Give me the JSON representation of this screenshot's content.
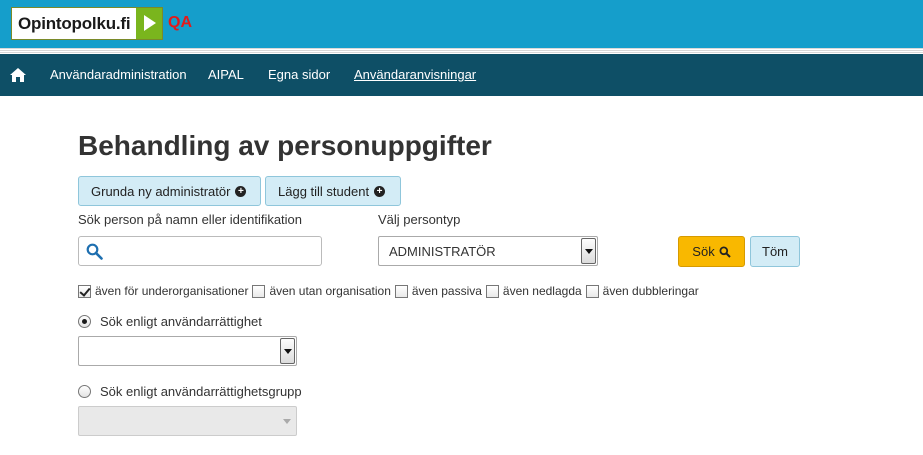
{
  "header": {
    "logo_text": "Opintopolku.fi",
    "env_label": "QA",
    "brand_color": "#159ecb",
    "env_color": "#e21a1a"
  },
  "nav": {
    "home_icon": "home-icon",
    "items": [
      {
        "label": "Användaradministration"
      },
      {
        "label": "AIPAL"
      },
      {
        "label": "Egna sidor"
      },
      {
        "label": "Användaranvisningar"
      }
    ],
    "bar_color": "#0e4f66"
  },
  "main": {
    "title": "Behandling av personuppgifter",
    "create_admin_label": "Grunda ny administratör",
    "add_student_label": "Lägg till student",
    "search_label": "Sök person på namn eller identifikation",
    "search_value": "",
    "person_type_label": "Välj persontyp",
    "person_type_value": "ADMINISTRATÖR",
    "search_button": "Sök",
    "clear_button": "Töm",
    "search_button_color": "#f9b800",
    "checkboxes": [
      {
        "label": "även för underorganisationer",
        "checked": true
      },
      {
        "label": "även utan organisation",
        "checked": false
      },
      {
        "label": "även passiva",
        "checked": false
      },
      {
        "label": "även nedlagda",
        "checked": false
      },
      {
        "label": "även dubbleringar",
        "checked": false
      }
    ],
    "radio_rights_label": "Sök enligt användarrättighet",
    "radio_rights_selected": true,
    "rights_select_value": "",
    "radio_group_label": "Sök enligt användarrättighetsgrupp",
    "radio_group_selected": false,
    "group_select_value": ""
  }
}
